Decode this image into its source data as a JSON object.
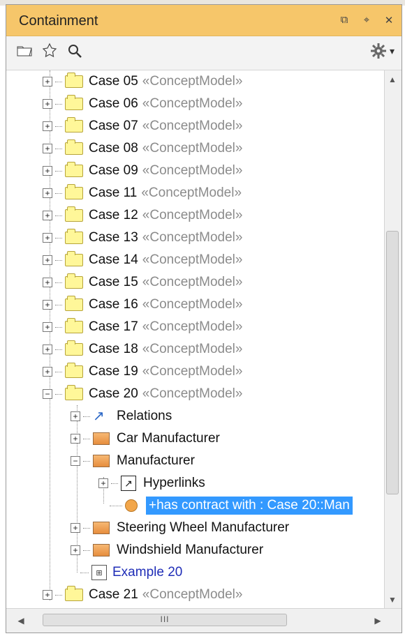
{
  "panel": {
    "title": "Containment",
    "window_buttons": [
      "restore-icon",
      "pin-icon",
      "close-icon"
    ]
  },
  "toolbar": {
    "left_icons": [
      "open-folder-icon",
      "star-icon",
      "search-icon"
    ],
    "right_icon": "gear-icon",
    "dropdown": "chevron-down-icon"
  },
  "tree": {
    "items": [
      {
        "label": "Case 05",
        "stereo": "«ConceptModel»"
      },
      {
        "label": "Case 06",
        "stereo": "«ConceptModel»"
      },
      {
        "label": "Case 07",
        "stereo": "«ConceptModel»"
      },
      {
        "label": "Case 08",
        "stereo": "«ConceptModel»"
      },
      {
        "label": "Case 09",
        "stereo": "«ConceptModel»"
      },
      {
        "label": "Case 11",
        "stereo": "«ConceptModel»"
      },
      {
        "label": "Case 12",
        "stereo": "«ConceptModel»"
      },
      {
        "label": "Case 13",
        "stereo": "«ConceptModel»"
      },
      {
        "label": "Case 14",
        "stereo": "«ConceptModel»"
      },
      {
        "label": "Case 15",
        "stereo": "«ConceptModel»"
      },
      {
        "label": "Case 16",
        "stereo": "«ConceptModel»"
      },
      {
        "label": "Case 17",
        "stereo": "«ConceptModel»"
      },
      {
        "label": "Case 18",
        "stereo": "«ConceptModel»"
      },
      {
        "label": "Case 19",
        "stereo": "«ConceptModel»"
      },
      {
        "label": "Case 20",
        "stereo": "«ConceptModel»"
      },
      {
        "label": "Relations"
      },
      {
        "label": "Car Manufacturer"
      },
      {
        "label": "Manufacturer"
      },
      {
        "label": "Hyperlinks"
      },
      {
        "label": "+has contract with : Case 20::Man"
      },
      {
        "label": "Steering Wheel Manufacturer"
      },
      {
        "label": "Windshield Manufacturer"
      },
      {
        "label": "Example 20"
      },
      {
        "label": "Case 21",
        "stereo": "«ConceptModel»"
      }
    ]
  },
  "scroll": {
    "h_grip": "III"
  }
}
